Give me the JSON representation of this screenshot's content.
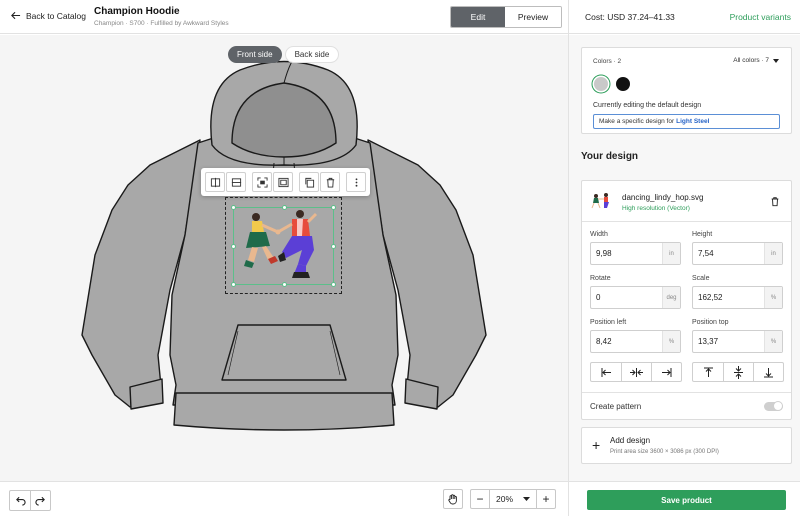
{
  "header": {
    "back_label": "Back to Catalog",
    "product_title": "Champion Hoodie",
    "product_subtitle": "Champion · S700 · Fulfilled by Awkward Styles",
    "edit_label": "Edit",
    "preview_label": "Preview"
  },
  "canvas": {
    "front_label": "Front side",
    "back_label": "Back side",
    "active_side": "Front side",
    "hoodie_color": "#a8a8a8"
  },
  "toolbar": {
    "icons": [
      "split-vertical-icon",
      "split-horizontal-icon",
      "fit-icon",
      "fill-icon",
      "duplicate-icon",
      "delete-icon",
      "more-icon"
    ]
  },
  "bottom": {
    "zoom": "20%",
    "zoom_minus": "−",
    "zoom_plus": "+"
  },
  "panel": {
    "cost": "Cost: USD 37.24–41.33",
    "variants_link": "Product variants",
    "colors_label": "Colors · 2",
    "all_colors_label": "All colors · 7",
    "swatches": [
      {
        "name": "Light Steel",
        "hex": "#c9c9c9",
        "selected": true
      },
      {
        "name": "Black",
        "hex": "#111111",
        "selected": false
      }
    ],
    "editing_text": "Currently editing the default design",
    "specific_prefix": "Make a specific design for",
    "specific_color": "Light Steel",
    "your_design": "Your design",
    "file_name": "dancing_lindy_hop.svg",
    "file_resolution": "High resolution (Vector)",
    "fields": {
      "width_label": "Width",
      "width_value": "9,98",
      "width_unit": "in",
      "height_label": "Height",
      "height_value": "7,54",
      "height_unit": "in",
      "rotate_label": "Rotate",
      "rotate_value": "0",
      "rotate_unit": "deg",
      "scale_label": "Scale",
      "scale_value": "162,52",
      "scale_unit": "%",
      "posleft_label": "Position left",
      "posleft_value": "8,42",
      "posleft_unit": "%",
      "postop_label": "Position top",
      "postop_value": "13,37",
      "postop_unit": "%"
    },
    "create_pattern": "Create pattern",
    "add_design": "Add design",
    "print_area": "Print area size 3600 × 3086 px (300 DPI)",
    "save_button": "Save product"
  },
  "colors": {
    "accent_green": "#2e9e5b",
    "dark_toggle": "#5f6368",
    "link_blue": "#2663c7"
  }
}
